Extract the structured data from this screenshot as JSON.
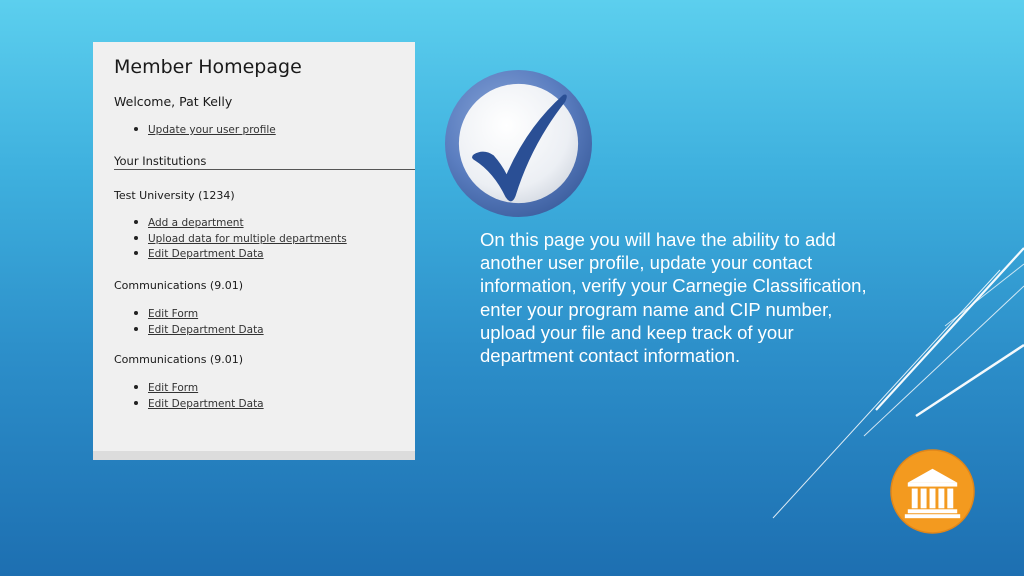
{
  "screenshot": {
    "title": "Member Homepage",
    "welcome": "Welcome, Pat Kelly",
    "profile_links": [
      {
        "label": "Update your user profile"
      }
    ],
    "institutions_heading": "Your Institutions",
    "groups": [
      {
        "title": "Test University (1234)",
        "links": [
          {
            "label": "Add a department"
          },
          {
            "label": "Upload data for multiple departments"
          },
          {
            "label": "Edit Department Data"
          }
        ]
      },
      {
        "title": "Communications (9.01)",
        "links": [
          {
            "label": "Edit Form"
          },
          {
            "label": "Edit Department Data"
          }
        ]
      },
      {
        "title": "Communications (9.01)",
        "links": [
          {
            "label": "Edit Form"
          },
          {
            "label": "Edit Department Data"
          }
        ]
      }
    ]
  },
  "slide": {
    "description": "On this page you will have the ability to add another user profile, update your contact information, verify your Carnegie Classification, enter your program name and CIP number, upload your file and keep track of your department contact information."
  },
  "icons": {
    "checkmark": "checkmark-icon",
    "logo": "institution-building-icon"
  },
  "colors": {
    "background_top": "#5ccfee",
    "background_bottom": "#1d6fb1",
    "panel": "#f0f0f0",
    "checkmark": "#2a4f95",
    "logo_orange": "#f39a1f",
    "text_white": "#ffffff"
  }
}
